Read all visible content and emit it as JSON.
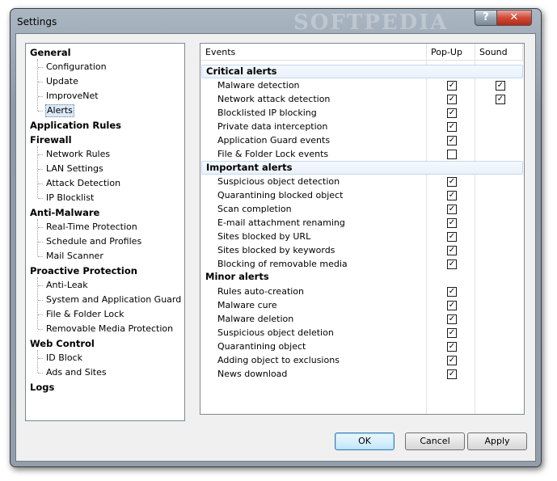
{
  "window": {
    "title": "Settings",
    "watermark": "SOFTPEDIA",
    "help_label": "?",
    "close_label": "✕"
  },
  "tree": {
    "categories": [
      {
        "label": "General",
        "items": [
          "Configuration",
          "Update",
          "ImproveNet",
          "Alerts"
        ]
      },
      {
        "label": "Application Rules",
        "items": []
      },
      {
        "label": "Firewall",
        "items": [
          "Network Rules",
          "LAN Settings",
          "Attack Detection",
          "IP Blocklist"
        ]
      },
      {
        "label": "Anti-Malware",
        "items": [
          "Real-Time Protection",
          "Schedule and Profiles",
          "Mail Scanner"
        ]
      },
      {
        "label": "Proactive Protection",
        "items": [
          "Anti-Leak",
          "System and Application Guard",
          "File & Folder Lock",
          "Removable Media Protection"
        ]
      },
      {
        "label": "Web Control",
        "items": [
          "ID Block",
          "Ads and Sites"
        ]
      },
      {
        "label": "Logs",
        "items": []
      }
    ],
    "selected": "Alerts"
  },
  "events": {
    "headers": {
      "events": "Events",
      "popup": "Pop-Up",
      "sound": "Sound"
    },
    "groups": [
      {
        "label": "Critical alerts",
        "rows": [
          {
            "label": "Malware detection",
            "popup": true,
            "sound": true
          },
          {
            "label": "Network attack detection",
            "popup": true,
            "sound": true
          },
          {
            "label": "Blocklisted IP blocking",
            "popup": true,
            "sound": false
          },
          {
            "label": "Private data interception",
            "popup": true,
            "sound": false
          },
          {
            "label": "Application Guard events",
            "popup": true,
            "sound": false
          },
          {
            "label": "File & Folder Lock events",
            "popup": false,
            "sound": false
          }
        ]
      },
      {
        "label": "Important alerts",
        "rows": [
          {
            "label": "Suspicious object detection",
            "popup": true,
            "sound": false
          },
          {
            "label": "Quarantining blocked object",
            "popup": true,
            "sound": false
          },
          {
            "label": "Scan completion",
            "popup": true,
            "sound": false
          },
          {
            "label": "E-mail attachment renaming",
            "popup": true,
            "sound": false
          },
          {
            "label": "Sites blocked by URL",
            "popup": true,
            "sound": false
          },
          {
            "label": "Sites blocked by keywords",
            "popup": true,
            "sound": false
          },
          {
            "label": "Blocking of removable media",
            "popup": true,
            "sound": false
          }
        ]
      },
      {
        "label": "Minor alerts",
        "rows": [
          {
            "label": "Rules auto-creation",
            "popup": true,
            "sound": false
          },
          {
            "label": "Malware cure",
            "popup": true,
            "sound": false
          },
          {
            "label": "Malware deletion",
            "popup": true,
            "sound": false
          },
          {
            "label": "Suspicious object deletion",
            "popup": true,
            "sound": false
          },
          {
            "label": "Quarantining object",
            "popup": true,
            "sound": false
          },
          {
            "label": "Adding object to exclusions",
            "popup": true,
            "sound": false
          },
          {
            "label": "News download",
            "popup": true,
            "sound": false
          }
        ]
      }
    ]
  },
  "buttons": {
    "ok": "OK",
    "cancel": "Cancel",
    "apply": "Apply"
  }
}
